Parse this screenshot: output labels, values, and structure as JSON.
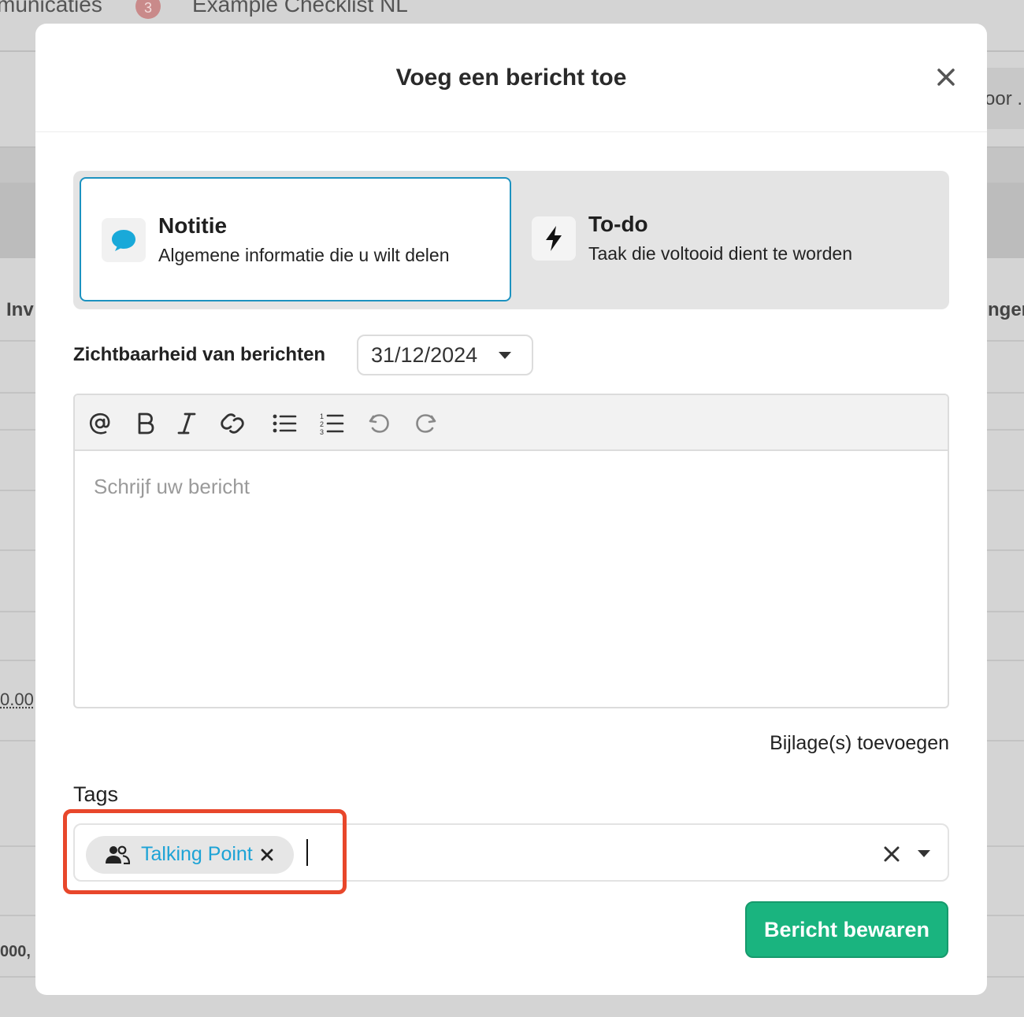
{
  "background": {
    "tab_communicaties": "municaties",
    "tab_badge": "3",
    "tab_checklist": "Example Checklist NL",
    "right_button_fragment": "oor .",
    "column_inv": "Inv",
    "column_nger": "nger",
    "amount_1": "0.00",
    "amount_2": "000,"
  },
  "modal": {
    "title": "Voeg een bericht toe",
    "type_options": [
      {
        "title": "Notitie",
        "description": "Algemene informatie die u wilt delen",
        "icon": "chat-bubble-icon",
        "selected": true
      },
      {
        "title": "To-do",
        "description": "Taak die voltooid dient te worden",
        "icon": "lightning-bolt-icon",
        "selected": false
      }
    ],
    "visibility_label": "Zichtbaarheid van berichten",
    "visibility_date": "31/12/2024",
    "editor": {
      "toolbar": [
        "mention-icon",
        "bold-icon",
        "italic-icon",
        "link-icon",
        "bullet-list-icon",
        "numbered-list-icon",
        "undo-icon",
        "redo-icon"
      ],
      "placeholder": "Schrijf uw bericht",
      "value": ""
    },
    "attach_label": "Bijlage(s) toevoegen",
    "tags_label": "Tags",
    "tags": [
      {
        "label": "Talking Point",
        "icon": "people-icon"
      }
    ],
    "save_label": "Bericht bewaren"
  },
  "colors": {
    "accent_blue": "#1c92c0",
    "tag_text": "#1da3d6",
    "save_green": "#1ab47f",
    "highlight_red": "#e8472b"
  }
}
